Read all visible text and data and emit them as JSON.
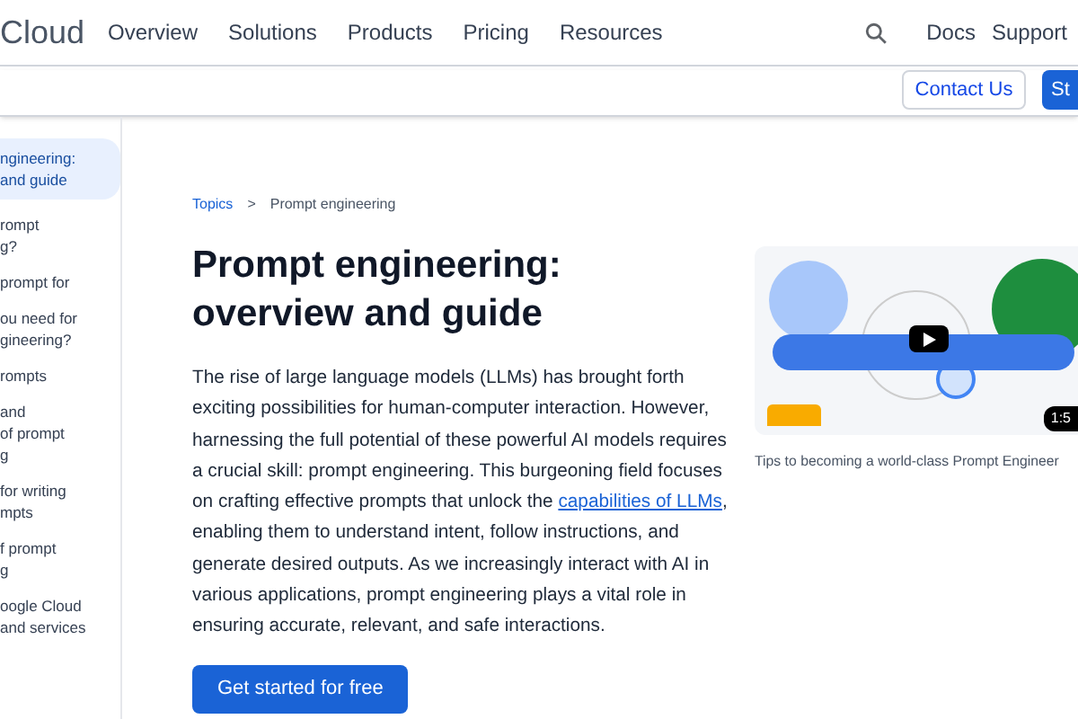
{
  "header": {
    "logo": "Cloud",
    "nav": [
      "Overview",
      "Solutions",
      "Products",
      "Pricing",
      "Resources"
    ],
    "links": [
      "Docs",
      "Support"
    ]
  },
  "subbar": {
    "buttons": [
      {
        "label": "Contact Us",
        "kind": "outline"
      },
      {
        "label": "St",
        "kind": "primary"
      }
    ]
  },
  "sidebar": {
    "items": [
      {
        "label": "ngineering:\nand guide",
        "selected": true
      },
      {
        "label": "rompt\ng?",
        "selected": false
      },
      {
        "label": "prompt for\n ",
        "selected": false
      },
      {
        "label": "ou need for\ngineering?",
        "selected": false
      },
      {
        "label": "rompts",
        "selected": false
      },
      {
        "label": "and\nof prompt\ng",
        "selected": false
      },
      {
        "label": "for writing\nmpts",
        "selected": false
      },
      {
        "label": "f prompt\ng",
        "selected": false
      },
      {
        "label": "oogle Cloud\nand services",
        "selected": false
      }
    ]
  },
  "breadcrumb": {
    "items": [
      "Topics",
      "Prompt engineering"
    ],
    "separator": ">"
  },
  "title": "Prompt engineering: overview and guide",
  "intro": [
    {
      "kind": "text",
      "text": "The rise of large language models (LLMs) has brought forth exciting possibilities for human-computer interaction. However, harnessing the full potential of these powerful AI models requires a crucial skill: prompt engineering. This burgeoning field focuses on crafting effective prompts that unlock the "
    },
    {
      "kind": "link",
      "text": "capabilities of LLMs"
    },
    {
      "kind": "text",
      "text": ", enabling them to understand intent, follow instructions, and generate desired outputs. As we increasingly interact with AI in various applications, prompt engineering plays a vital role in ensuring accurate, relevant, and safe interactions."
    }
  ],
  "cta": "Get started for free",
  "video": {
    "duration": "1:5",
    "caption": "Tips to becoming a world-class Prompt Engineer"
  }
}
